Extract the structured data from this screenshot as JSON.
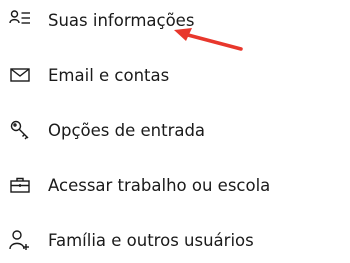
{
  "nav": {
    "items": [
      {
        "label": "Suas informações",
        "icon": "person-lines-icon"
      },
      {
        "label": "Email e contas",
        "icon": "mail-icon"
      },
      {
        "label": "Opções de entrada",
        "icon": "key-icon"
      },
      {
        "label": "Acessar trabalho ou escola",
        "icon": "briefcase-icon"
      },
      {
        "label": "Família e outros usuários",
        "icon": "person-add-icon"
      }
    ]
  },
  "annotation": {
    "arrow_color": "#e8372c",
    "points_to": "Suas informações"
  },
  "colors": {
    "text": "#1a1a1a",
    "background": "#ffffff"
  }
}
